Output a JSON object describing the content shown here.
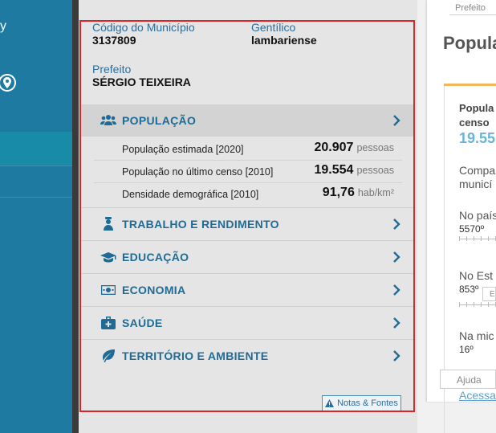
{
  "sidebar": {
    "partial_text": "y"
  },
  "municipio": {
    "codigo_label": "Código do Município",
    "codigo_value": "3137809",
    "gentilico_label": "Gentílico",
    "gentilico_value": "lambariense",
    "prefeito_label": "Prefeito",
    "prefeito_value": "SÉRGIO TEIXEIRA"
  },
  "categories": [
    {
      "label": "POPULAÇÃO",
      "icon": "people-icon",
      "expanded": true
    },
    {
      "label": "TRABALHO E RENDIMENTO",
      "icon": "worker-icon"
    },
    {
      "label": "EDUCAÇÃO",
      "icon": "graduation-cap-icon"
    },
    {
      "label": "ECONOMIA",
      "icon": "money-icon"
    },
    {
      "label": "SAÚDE",
      "icon": "medical-kit-icon"
    },
    {
      "label": "TERRITÓRIO E AMBIENTE",
      "icon": "leaf-icon"
    }
  ],
  "populacao": [
    {
      "label": "População estimada [2020]",
      "value": "20.907",
      "unit": "pessoas"
    },
    {
      "label": "População no último censo [2010]",
      "value": "19.554",
      "unit": "pessoas"
    },
    {
      "label": "Densidade demográfica [2010]",
      "value": "91,76",
      "unit": "hab/km²"
    }
  ],
  "notes_button": "Notas & Fontes",
  "background_page": {
    "prefeito_label": "Prefeito",
    "title": "Popula",
    "card_line1": "Popula",
    "card_line2": "censo",
    "card_big": "19.55",
    "compare_line1": "Compa",
    "compare_line2": "municí",
    "pais_label": "No país",
    "pais_value": "5570º",
    "estado_label": "No Est",
    "estado_value": "853º",
    "micro_label": "Na mic",
    "micro_value": "16º",
    "mini_box": "E",
    "ajuda": "Ajuda",
    "acessar": "Acessar"
  }
}
